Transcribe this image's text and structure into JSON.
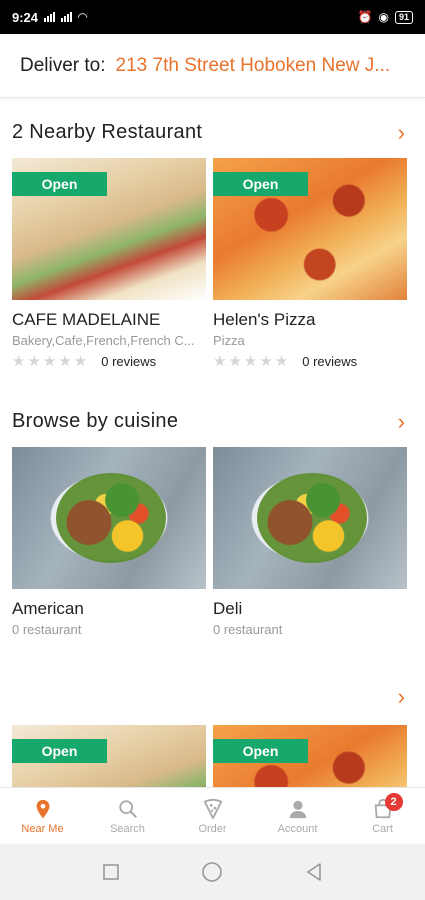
{
  "status_bar": {
    "time": "9:24",
    "battery": "91"
  },
  "header": {
    "deliver_label": "Deliver to:",
    "address": "213 7th Street Hoboken New J..."
  },
  "nearby": {
    "title": "2 Nearby Restaurant",
    "restaurants": [
      {
        "badge": "Open",
        "name": "CAFE MADELAINE",
        "tags": "Bakery,Cafe,French,French C...",
        "stars": "★★★★★",
        "reviews": "0 reviews"
      },
      {
        "badge": "Open",
        "name": "Helen's Pizza",
        "tags": "Pizza",
        "stars": "★★★★★",
        "reviews": "0 reviews"
      }
    ]
  },
  "cuisine": {
    "title": "Browse by cuisine",
    "items": [
      {
        "name": "American",
        "count": "0 restaurant"
      },
      {
        "name": "Deli",
        "count": "0 restaurant"
      }
    ]
  },
  "third_section": {
    "badges": [
      "Open",
      "Open"
    ]
  },
  "bottom_nav": {
    "items": [
      {
        "label": "Near Me",
        "icon": "location-pin-icon"
      },
      {
        "label": "Search",
        "icon": "search-icon"
      },
      {
        "label": "Order",
        "icon": "pizza-slice-icon"
      },
      {
        "label": "Account",
        "icon": "user-icon"
      },
      {
        "label": "Cart",
        "icon": "cart-icon"
      }
    ],
    "cart_count": "2"
  },
  "colors": {
    "accent": "#e8732c",
    "open_badge": "#17a86b",
    "cart_badge": "#e53935"
  }
}
